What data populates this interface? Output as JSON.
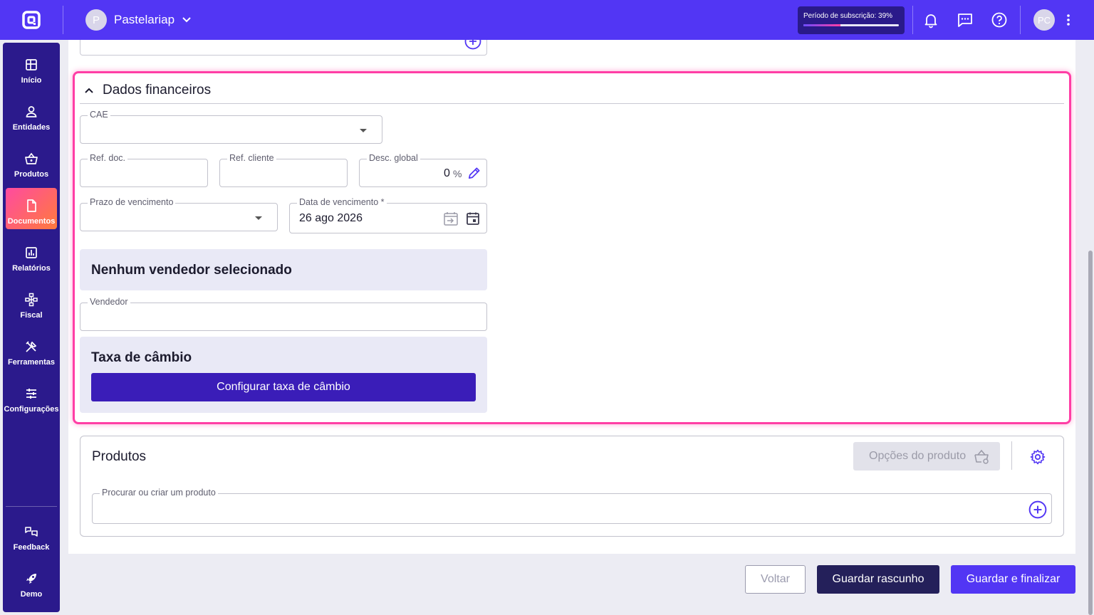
{
  "topbar": {
    "company_initial": "P",
    "company_name": "Pastelariap",
    "subscription_label": "Período de subscrição: 39%",
    "subscription_progress": 39,
    "user_initials": "PC"
  },
  "sidebar": {
    "items": [
      {
        "label": "Início",
        "icon": "home-icon"
      },
      {
        "label": "Entidades",
        "icon": "user-icon"
      },
      {
        "label": "Produtos",
        "icon": "basket-icon"
      },
      {
        "label": "Documentos",
        "icon": "document-icon",
        "active": true
      },
      {
        "label": "Relatórios",
        "icon": "chart-icon"
      },
      {
        "label": "Fiscal",
        "icon": "hierarchy-icon"
      },
      {
        "label": "Ferramentas",
        "icon": "tools-icon"
      },
      {
        "label": "Configurações",
        "icon": "sliders-icon"
      },
      {
        "label": "Feedback",
        "icon": "feedback-icon"
      },
      {
        "label": "Demo",
        "icon": "rocket-icon"
      }
    ]
  },
  "financial": {
    "title": "Dados financeiros",
    "cae_label": "CAE",
    "ref_doc_label": "Ref. doc.",
    "ref_cliente_label": "Ref. cliente",
    "desc_global_label": "Desc. global",
    "desc_global_value": "0",
    "desc_global_unit": "%",
    "prazo_label": "Prazo de vencimento",
    "data_label": "Data de vencimento *",
    "data_value": "26 ago 2026",
    "seller_heading": "Nenhum vendedor selecionado",
    "vendedor_label": "Vendedor",
    "exchange_heading": "Taxa de câmbio",
    "exchange_button": "Configurar taxa de câmbio"
  },
  "products": {
    "title": "Produtos",
    "options_button": "Opções do produto",
    "search_label": "Procurar ou criar um produto"
  },
  "actions": {
    "back": "Voltar",
    "save_draft": "Guardar rascunho",
    "save_finalize": "Guardar e finalizar"
  },
  "colors": {
    "brand": "#5236f4",
    "sidebar": "#2b1a8c",
    "highlight": "#ff3ea5"
  }
}
